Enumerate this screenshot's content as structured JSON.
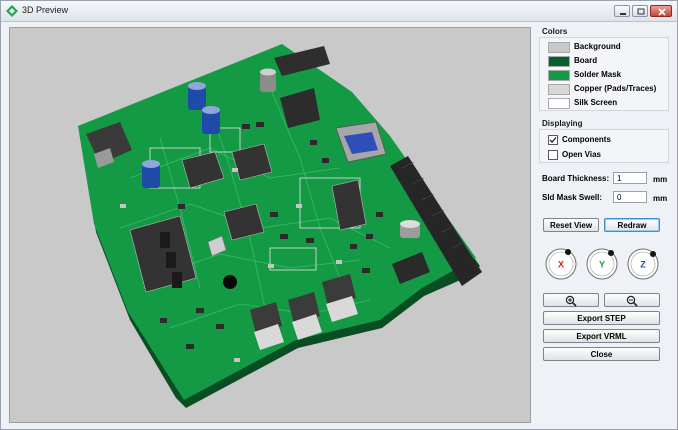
{
  "window": {
    "title": "3D Preview"
  },
  "icons": {
    "app": "board-preview-icon",
    "minimize": "minimize-icon",
    "maximize": "maximize-icon",
    "close": "close-icon",
    "zoom_in": "zoom-in-icon",
    "zoom_out": "zoom-out-icon"
  },
  "colors_section": {
    "title": "Colors",
    "items": [
      {
        "label": "Background",
        "color": "#c9c9c9"
      },
      {
        "label": "Board",
        "color": "#0b5f2c"
      },
      {
        "label": "Solder Mask",
        "color": "#149a45"
      },
      {
        "label": "Copper (Pads/Traces)",
        "color": "#d7d7d7"
      },
      {
        "label": "Silk Screen",
        "color": "#ffffff"
      }
    ]
  },
  "displaying_section": {
    "title": "Displaying",
    "components": {
      "label": "Components",
      "checked": true
    },
    "open_vias": {
      "label": "Open Vias",
      "checked": false
    }
  },
  "board_thickness": {
    "label": "Board Thickness:",
    "value": "1",
    "unit": "mm"
  },
  "sld_mask_swell": {
    "label": "Sld Mask Swell:",
    "value": "0",
    "unit": "mm"
  },
  "buttons": {
    "reset_view": "Reset View",
    "redraw": "Redraw",
    "export_step": "Export STEP",
    "export_vrml": "Export VRML",
    "close": "Close"
  },
  "axes": [
    {
      "label": "X",
      "color": "#d21f1f"
    },
    {
      "label": "Y",
      "color": "#1e9a2f"
    },
    {
      "label": "Z",
      "color": "#2a3fd0"
    }
  ]
}
